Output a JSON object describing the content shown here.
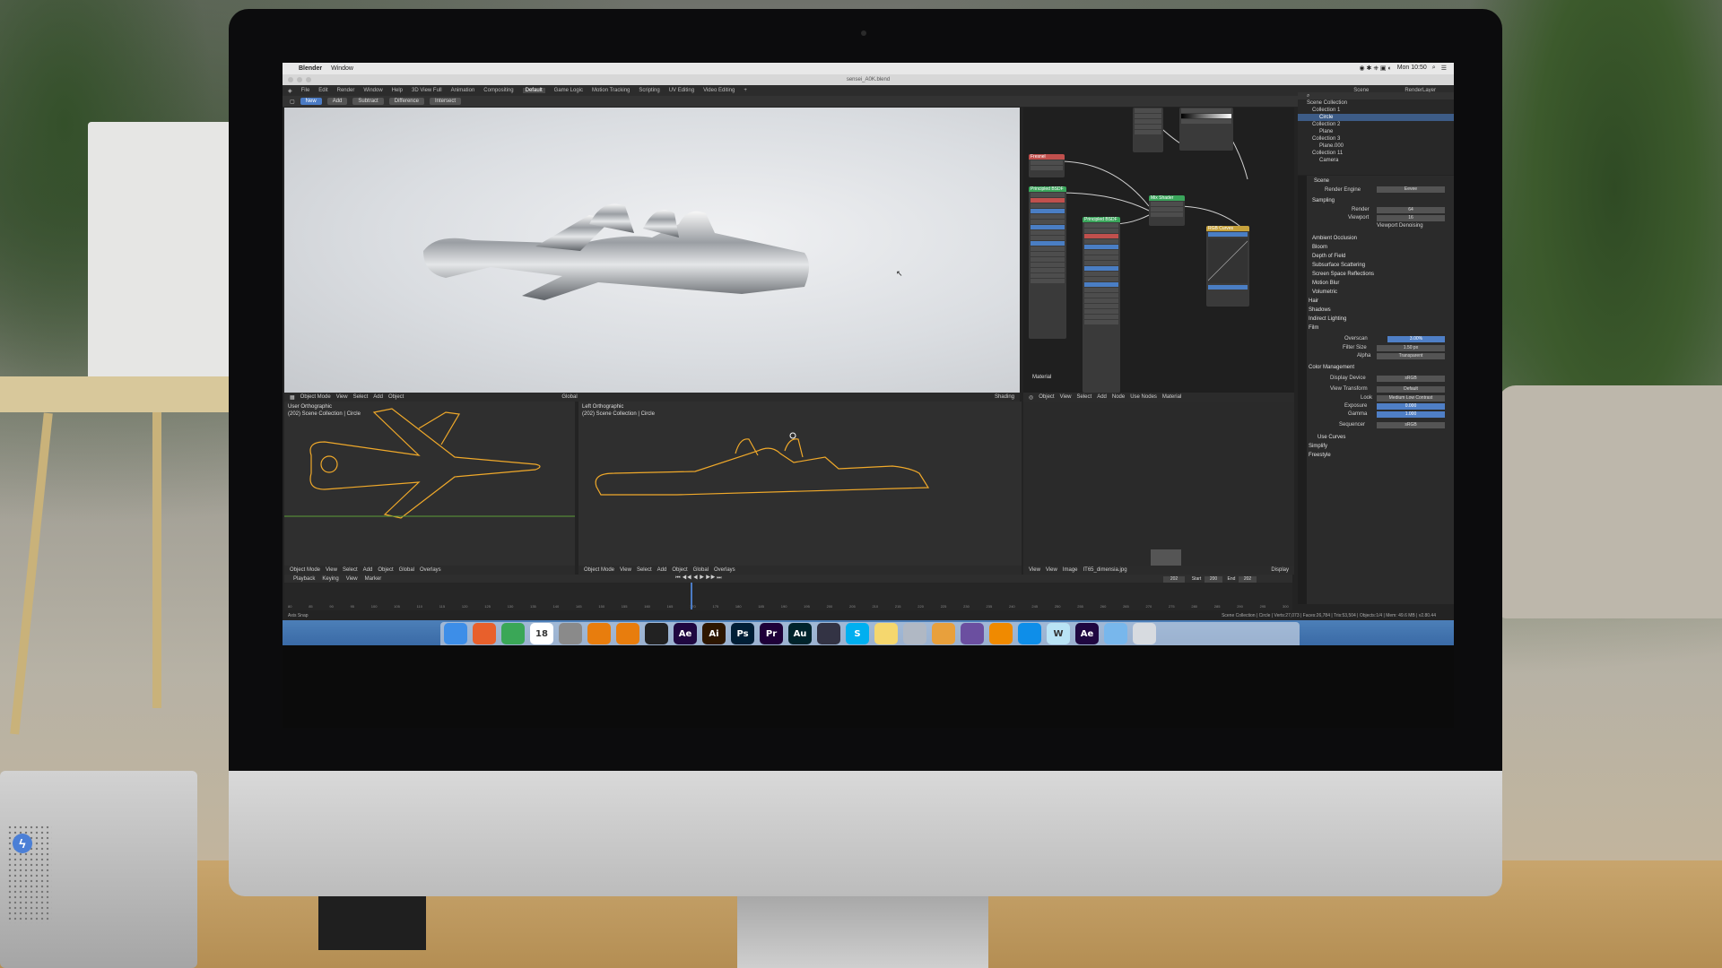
{
  "menubar": {
    "app": "Blender",
    "items": [
      "Window"
    ],
    "clock": "Mon 10:50"
  },
  "window": {
    "title": "sensei_A0K.blend"
  },
  "topbar": {
    "menus": [
      "File",
      "Edit",
      "Render",
      "Window",
      "Help"
    ],
    "workspaces": [
      "3D View Full",
      "Animation",
      "Compositing",
      "Default",
      "Game Logic",
      "Motion Tracking",
      "Scripting",
      "UV Editing",
      "Video Editing"
    ],
    "active_workspace": "Default",
    "scene_label": "Scene",
    "renderlayer_label": "RenderLayer"
  },
  "toolbar": {
    "buttons": [
      "New",
      "Add",
      "Subtract",
      "Difference",
      "Intersect"
    ],
    "active": "New"
  },
  "viewport_main": {
    "header": [
      "Object Mode",
      "View",
      "Select",
      "Add",
      "Object"
    ],
    "orientation": "Global",
    "shading": "Shading"
  },
  "node_editor": {
    "header": [
      "Object",
      "View",
      "Select",
      "Add",
      "Node",
      "Use Nodes"
    ],
    "material_label": "Material",
    "node_label": "Material",
    "nodes": [
      "Fresnel",
      "Principled BSDF",
      "Principled BSDF",
      "Mix Shader",
      "RGB Curves"
    ]
  },
  "image_editor": {
    "header": [
      "View",
      "View",
      "Image"
    ],
    "image_name": "IT65_dimensia.jpg",
    "display": "Display"
  },
  "vp_left": {
    "title": "User Orthographic",
    "subtitle": "(202) Scene Collection | Circle",
    "header": [
      "Object Mode",
      "View",
      "Select",
      "Add",
      "Object"
    ],
    "orientation": "Global",
    "overlays": "Overlays"
  },
  "vp_right": {
    "title": "Left Orthographic",
    "subtitle": "(202) Scene Collection | Circle",
    "header": [
      "Object Mode",
      "View",
      "Select",
      "Add",
      "Object"
    ],
    "orientation": "Global",
    "overlays": "Overlays"
  },
  "outliner": {
    "title": "Scene Collection",
    "rows": [
      {
        "label": "Collection 1",
        "level": 1
      },
      {
        "label": "Circle",
        "level": 2,
        "selected": true
      },
      {
        "label": "Collection 2",
        "level": 1
      },
      {
        "label": "Plane",
        "level": 2
      },
      {
        "label": "Collection 3",
        "level": 1
      },
      {
        "label": "Plane.000",
        "level": 2
      },
      {
        "label": "Collection 11",
        "level": 1
      },
      {
        "label": "Camera",
        "level": 2
      }
    ]
  },
  "properties": {
    "scene": "Scene",
    "render_engine_label": "Render Engine",
    "render_engine": "Eevee",
    "sampling": "Sampling",
    "render_label": "Render",
    "render_value": "64",
    "viewport_label": "Viewport",
    "viewport_value": "16",
    "viewport_denoising": "Viewport Denoising",
    "sections": [
      "Ambient Occlusion",
      "Bloom",
      "Depth of Field",
      "Subsurface Scattering",
      "Screen Space Reflections",
      "Motion Blur",
      "Volumetric",
      "Hair",
      "Shadows",
      "Indirect Lighting",
      "Film"
    ],
    "overscan_label": "Overscan",
    "overscan_value": "3.00%",
    "filter_size_label": "Filter Size",
    "filter_size_value": "1.50 px",
    "alpha_label": "Alpha",
    "alpha_value": "Transparent",
    "color_management": "Color Management",
    "display_device_label": "Display Device",
    "display_device": "sRGB",
    "view_transform_label": "View Transform",
    "view_transform": "Default",
    "look_label": "Look",
    "look": "Medium Low Contrast",
    "exposure_label": "Exposure",
    "exposure": "0.000",
    "gamma_label": "Gamma",
    "gamma": "1.000",
    "sequencer_label": "Sequencer",
    "sequencer": "sRGB",
    "use_curves": "Use Curves",
    "simplify": "Simplify",
    "freestyle": "Freestyle"
  },
  "timeline": {
    "header": [
      "Playback",
      "Keying",
      "View",
      "Marker"
    ],
    "current_frame": "202",
    "start_label": "Start",
    "start": "200",
    "end_label": "End",
    "end": "202",
    "ticks": [
      "80",
      "85",
      "90",
      "95",
      "100",
      "105",
      "110",
      "115",
      "120",
      "125",
      "130",
      "135",
      "140",
      "145",
      "150",
      "155",
      "160",
      "165",
      "170",
      "175",
      "180",
      "185",
      "190",
      "195",
      "200",
      "205",
      "210",
      "215",
      "220",
      "225",
      "230",
      "235",
      "240",
      "245",
      "250",
      "255",
      "260",
      "265",
      "270",
      "275",
      "280",
      "285",
      "290",
      "295",
      "300"
    ]
  },
  "statusbar": {
    "left": "Axis Snap",
    "stats": "Scene Collection | Circle | Verts:27,073 | Faces:26,784 | Tris:53,504 | Objects:1/4 | Mem: 49.6 MB | v2.80.44"
  },
  "dock": {
    "icons": [
      {
        "name": "finder-icon",
        "label": "",
        "color": "#3d8ee8"
      },
      {
        "name": "firefox-icon",
        "label": "",
        "color": "#e8602c"
      },
      {
        "name": "chrome-icon",
        "label": "",
        "color": "#3aa757"
      },
      {
        "name": "calendar-icon",
        "label": "18",
        "color": "#ffffff"
      },
      {
        "name": "system-preferences-icon",
        "label": "",
        "color": "#8a8a8a"
      },
      {
        "name": "blender-icon",
        "label": "",
        "color": "#e87d0d"
      },
      {
        "name": "blender-icon-2",
        "label": "",
        "color": "#e87d0d"
      },
      {
        "name": "terminal-icon",
        "label": "",
        "color": "#222222"
      },
      {
        "name": "after-effects-icon",
        "label": "Ae",
        "color": "#1f0740"
      },
      {
        "name": "illustrator-icon",
        "label": "Ai",
        "color": "#2d1600"
      },
      {
        "name": "photoshop-icon",
        "label": "Ps",
        "color": "#001e36"
      },
      {
        "name": "premiere-icon",
        "label": "Pr",
        "color": "#1e0038"
      },
      {
        "name": "audition-icon",
        "label": "Au",
        "color": "#00232b"
      },
      {
        "name": "davinci-icon",
        "label": "",
        "color": "#333344"
      },
      {
        "name": "skype-icon",
        "label": "S",
        "color": "#00aff0"
      },
      {
        "name": "notes-icon",
        "label": "",
        "color": "#f5d76e"
      },
      {
        "name": "preview-icon",
        "label": "",
        "color": "#b0b8c4"
      },
      {
        "name": "pdf-icon",
        "label": "",
        "color": "#e8a03c"
      },
      {
        "name": "imovie-icon",
        "label": "",
        "color": "#6b4fa0"
      },
      {
        "name": "vlc-icon",
        "label": "",
        "color": "#f08a00"
      },
      {
        "name": "teamviewer-icon",
        "label": "",
        "color": "#0e8ee9"
      },
      {
        "name": "word-icon",
        "label": "W",
        "color": "#b9e3f5"
      },
      {
        "name": "after-effects-icon-2",
        "label": "Ae",
        "color": "#1f0740"
      },
      {
        "name": "folder-icon",
        "label": "",
        "color": "#78b7ec"
      },
      {
        "name": "trash-icon",
        "label": "",
        "color": "#d7dbe0"
      }
    ]
  },
  "colors": {
    "accent": "#4b7bc4",
    "wireframe": "#f0a92a",
    "node_green": "#3aa55b",
    "node_red": "#c0504d"
  }
}
